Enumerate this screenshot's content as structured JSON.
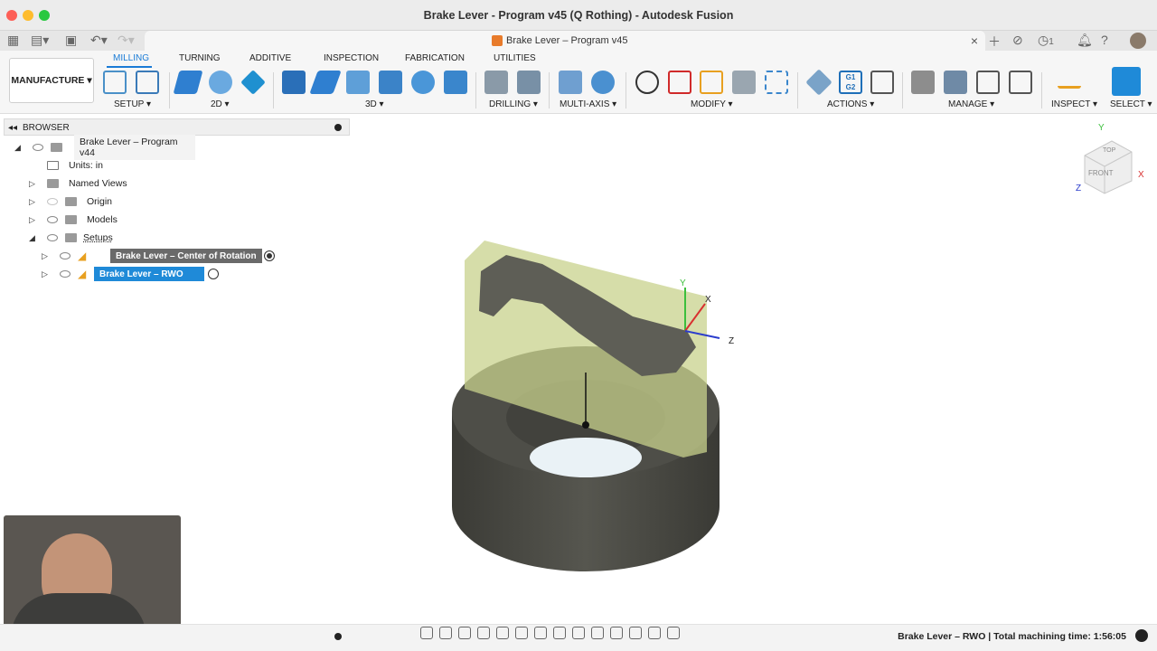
{
  "window": {
    "title": "Brake Lever - Program v45 (Q Rothing) - Autodesk Fusion"
  },
  "doc_tab": {
    "label": "Brake Lever – Program v45",
    "close": "×"
  },
  "top_bar": {
    "jobs_count": "1"
  },
  "workspace": {
    "label": "MANUFACTURE",
    "caret": "▾"
  },
  "ribbon_tabs": [
    "MILLING",
    "TURNING",
    "ADDITIVE",
    "INSPECTION",
    "FABRICATION",
    "UTILITIES"
  ],
  "groups": {
    "setup": "SETUP ▾",
    "g2d": "2D ▾",
    "g3d": "3D ▾",
    "drilling": "DRILLING ▾",
    "multiaxis": "MULTI-AXIS ▾",
    "modify": "MODIFY ▾",
    "actions": "ACTIONS ▾",
    "manage": "MANAGE ▾",
    "inspect": "INSPECT ▾",
    "select": "SELECT ▾"
  },
  "browser": {
    "header": "BROWSER",
    "items": {
      "root": "Brake Lever – Program v44",
      "units": "Units: in",
      "named_views": "Named Views",
      "origin": "Origin",
      "models": "Models",
      "setups": "Setups",
      "setup1": "Brake Lever – Center of Rotation",
      "setup2": "Brake Lever – RWO"
    }
  },
  "viewcube": {
    "top": "TOP",
    "front": "FRONT",
    "x": "X",
    "y": "Y",
    "z": "Z"
  },
  "triad": {
    "x": "X",
    "y": "Y",
    "z": "Z"
  },
  "status": {
    "text": "Brake Lever – RWO | Total machining time: 1:56:05"
  },
  "colors": {
    "accent": "#1a7bd6",
    "selected_row": "#1f8ad8",
    "setup_row": "#6a6a6a"
  }
}
